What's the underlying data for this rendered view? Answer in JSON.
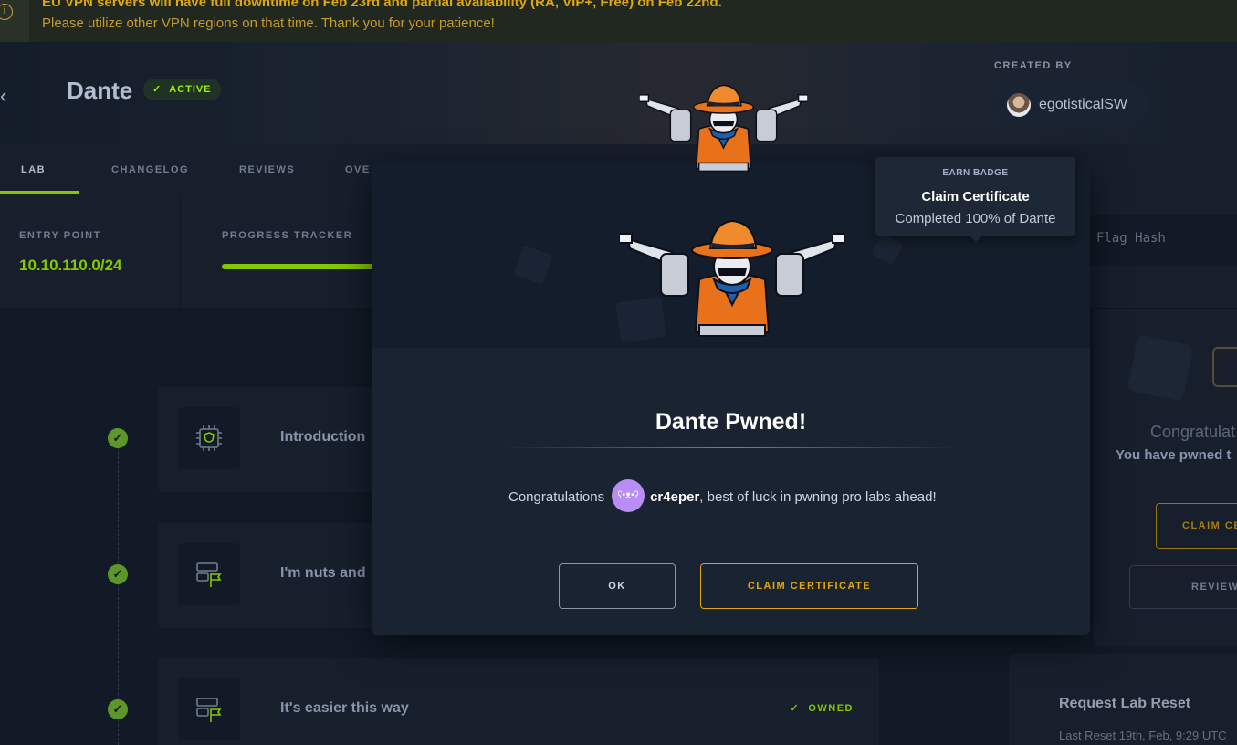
{
  "banner": {
    "line1": "EU VPN servers will have full downtime on Feb 23rd and partial availability (RA, VIP+, Free) on Feb 22nd.",
    "line2": "Please utilize other VPN regions on that time. Thank you for your patience!",
    "icon": "info-icon"
  },
  "header": {
    "back_icon": "chevron-left-icon",
    "title": "Dante",
    "status": "ACTIVE",
    "created_by_label": "CREATED BY",
    "creator": "egotisticalSW"
  },
  "tabs": [
    "LAB",
    "CHANGELOG",
    "REVIEWS",
    "OVE"
  ],
  "info": {
    "entry_label": "ENTRY POINT",
    "entry_value": "10.10.110.0/24",
    "progress_label": "PROGRESS TRACKER",
    "progress_fraction": 1.0,
    "flag_placeholder": "Flag Hash"
  },
  "timeline": [
    {
      "title": "Introduction",
      "icon": "chip-shield-icon",
      "status": ""
    },
    {
      "title": "I'm nuts and",
      "icon": "server-flag-icon",
      "status": ""
    },
    {
      "title": "It's easier this way",
      "icon": "server-flag-icon",
      "status": "OWNED"
    }
  ],
  "right_panel": {
    "congrats": "Congratulat",
    "pwned": "You have pwned t",
    "claim": "CLAIM CE",
    "review": "REVIEW",
    "reset_title": "Request Lab Reset",
    "reset_sub": "Last Reset 19th, Feb, 9:29 UTC"
  },
  "modal": {
    "title": "Dante Pwned!",
    "msg_prefix": "Congratulations",
    "username": "cr4eper",
    "msg_suffix": ", best of luck in pwning pro labs ahead!",
    "ok_label": "OK",
    "claim_label": "CLAIM CERTIFICATE"
  },
  "tooltip": {
    "label": "EARN BADGE",
    "title": "Claim Certificate",
    "subtitle": "Completed 100% of Dante"
  },
  "colors": {
    "accent_green": "#9fef00",
    "accent_gold": "#e0a80e",
    "bg_dark": "#141d2b",
    "bg_panel": "#1a2332"
  }
}
